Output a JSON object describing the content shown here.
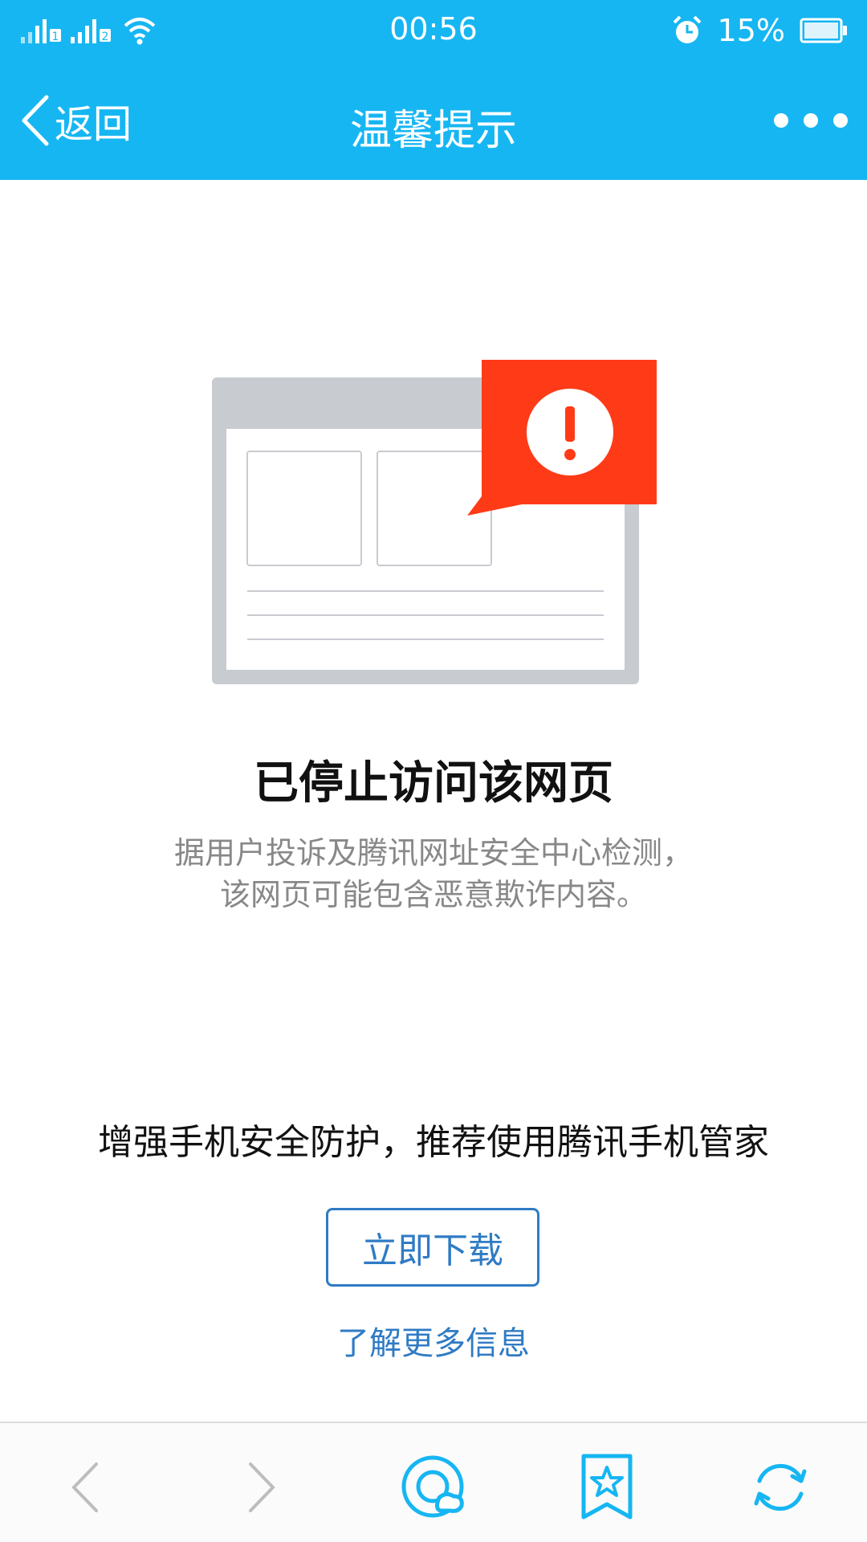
{
  "status_bar": {
    "time": "00:56",
    "battery": "15%",
    "sim1": "1",
    "sim2": "2"
  },
  "nav": {
    "back_label": "返回",
    "title": "温馨提示"
  },
  "main": {
    "title": "已停止访问该网页",
    "description_line1": "据用户投诉及腾讯网址安全中心检测，",
    "description_line2": "该网页可能包含恶意欺诈内容。",
    "promo": "增强手机安全防护，推荐使用腾讯手机管家",
    "download_button": "立即下载",
    "learn_more": "了解更多信息"
  },
  "colors": {
    "accent": "#16b6f2",
    "warning": "#ff3b17",
    "link": "#2f7bc4"
  },
  "toolbar": {
    "icons": [
      "back-arrow-icon",
      "forward-arrow-icon",
      "qq-browser-icon",
      "bookmark-star-icon",
      "refresh-icon"
    ]
  }
}
